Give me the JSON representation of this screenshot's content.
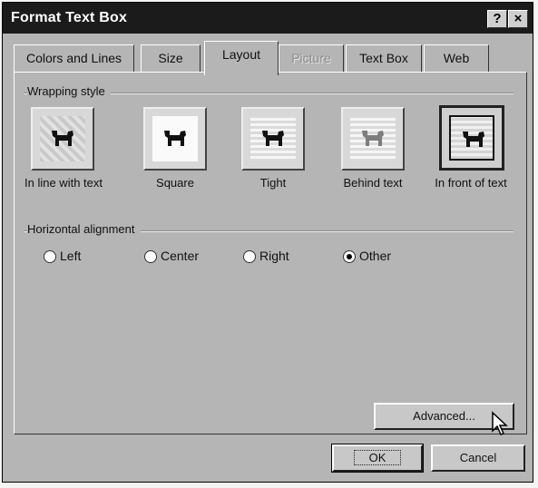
{
  "window": {
    "title": "Format Text Box",
    "help_label": "?",
    "close_label": "×"
  },
  "tabs": [
    {
      "label": "Colors and Lines",
      "state": "normal"
    },
    {
      "label": "Size",
      "state": "normal"
    },
    {
      "label": "Layout",
      "state": "active"
    },
    {
      "label": "Picture",
      "state": "disabled"
    },
    {
      "label": "Text Box",
      "state": "normal"
    },
    {
      "label": "Web",
      "state": "normal"
    }
  ],
  "wrapping": {
    "group_label": "Wrapping style",
    "options": [
      {
        "label": "In line with text",
        "selected": false
      },
      {
        "label": "Square",
        "selected": false
      },
      {
        "label": "Tight",
        "selected": false
      },
      {
        "label": "Behind text",
        "selected": false
      },
      {
        "label": "In front of text",
        "selected": true
      }
    ]
  },
  "alignment": {
    "group_label": "Horizontal alignment",
    "options": [
      {
        "label": "Left",
        "selected": false
      },
      {
        "label": "Center",
        "selected": false
      },
      {
        "label": "Right",
        "selected": false
      },
      {
        "label": "Other",
        "selected": true
      }
    ]
  },
  "buttons": {
    "advanced": "Advanced...",
    "ok": "OK",
    "cancel": "Cancel"
  },
  "icons": {
    "picture": "dog-silhouette-icon",
    "pointer": "mouse-pointer-icon"
  }
}
